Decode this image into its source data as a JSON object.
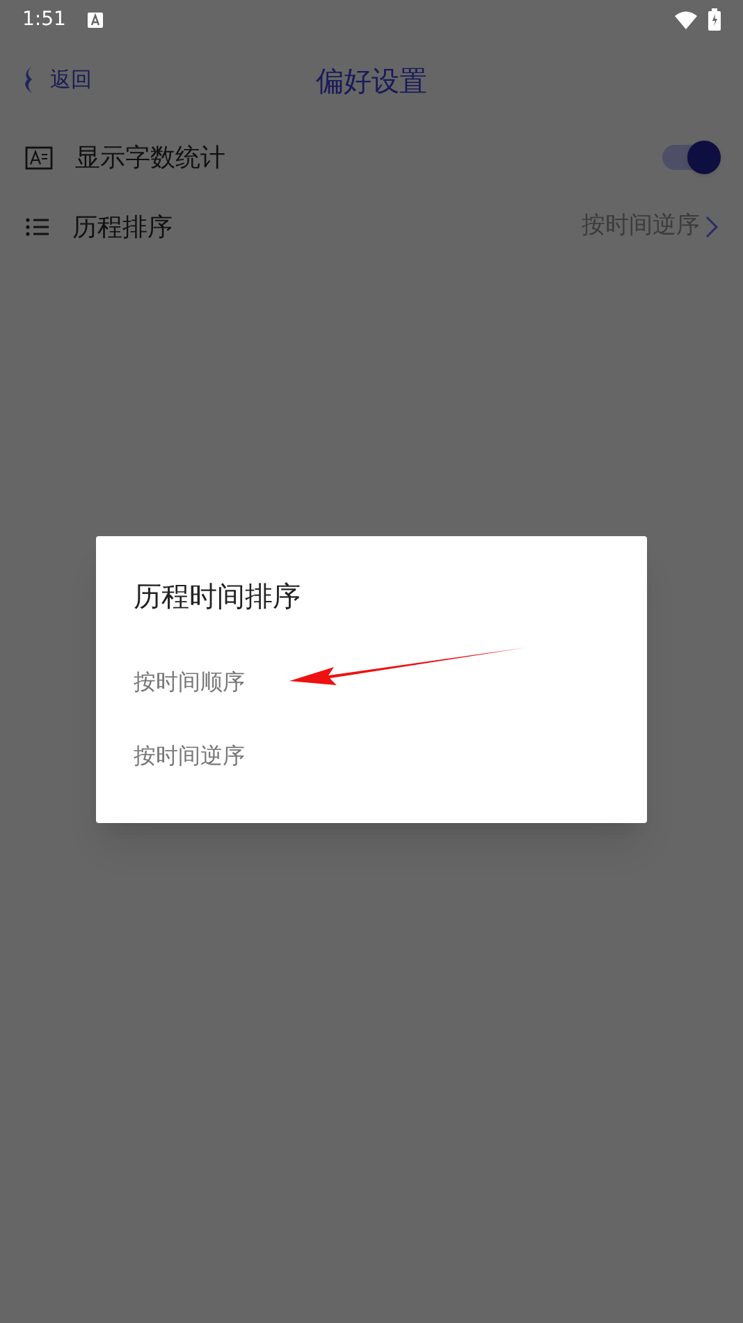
{
  "status_bar": {
    "time": "1:51"
  },
  "header": {
    "back": "返回",
    "title": "偏好设置"
  },
  "settings": [
    {
      "kind": "toggle",
      "label": "显示字数统计",
      "on": true
    },
    {
      "kind": "link",
      "label": "历程排序",
      "value": "按时间逆序"
    }
  ],
  "dialog": {
    "title": "历程时间排序",
    "options": [
      "按时间顺序",
      "按时间逆序"
    ]
  }
}
